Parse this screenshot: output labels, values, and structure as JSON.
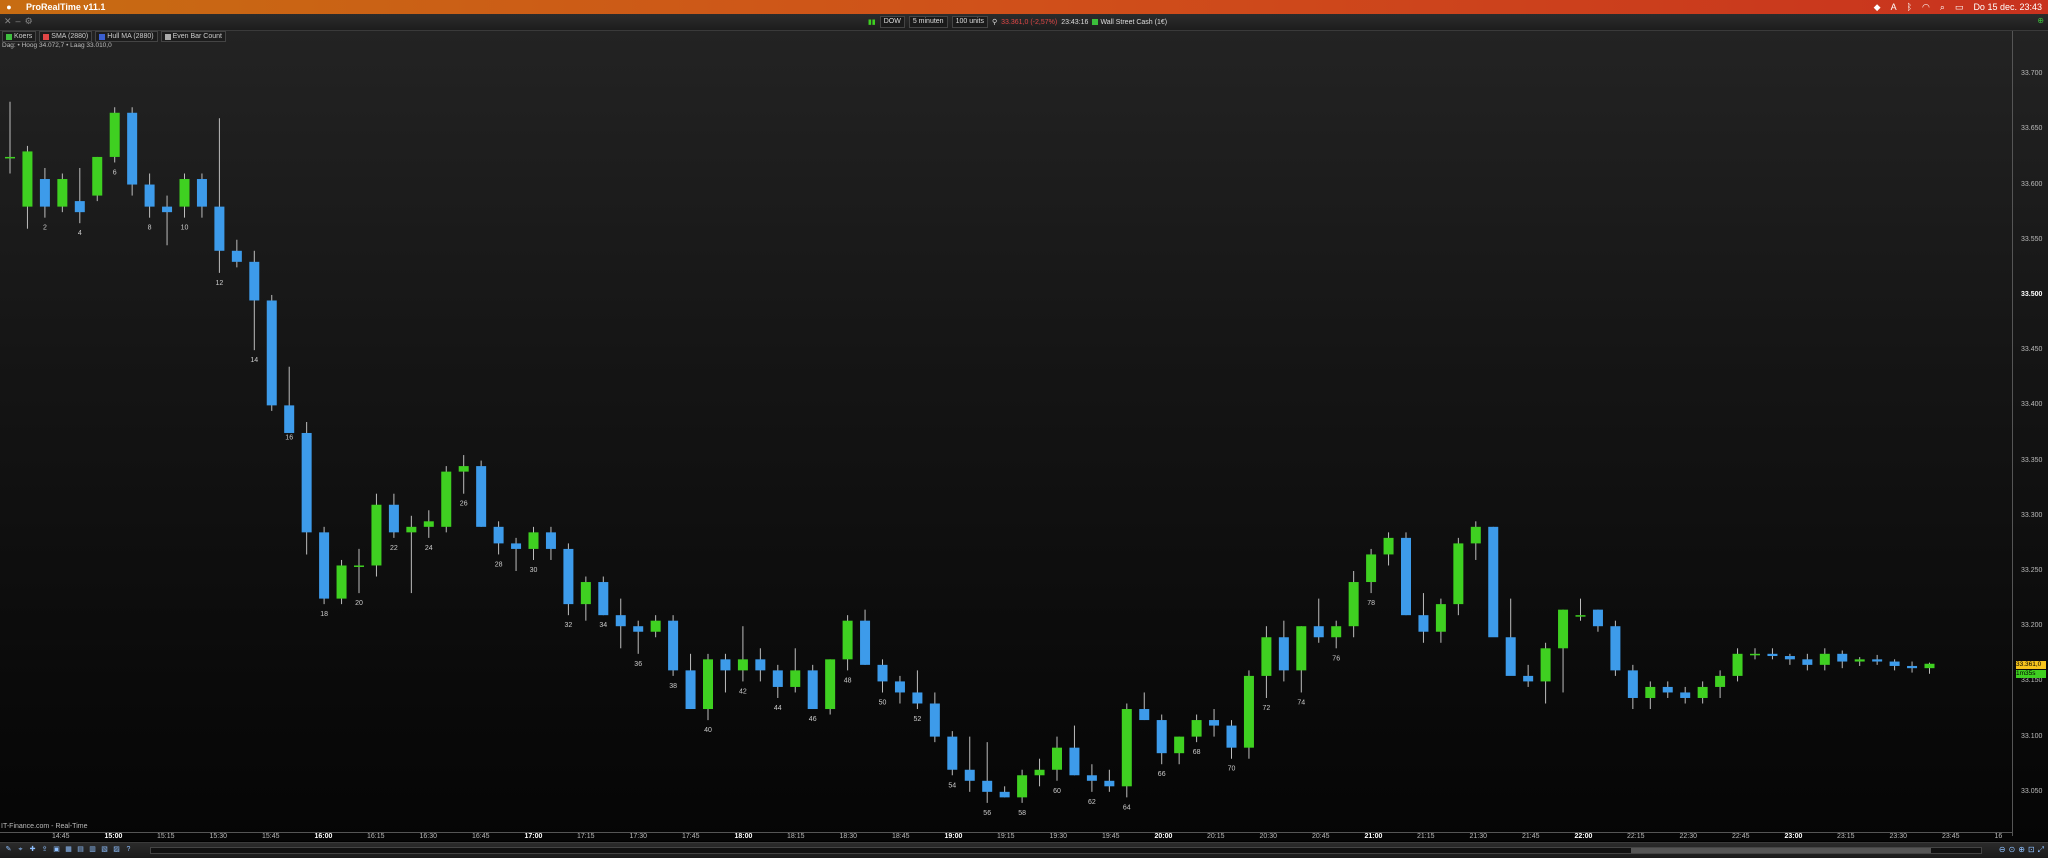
{
  "menubar": {
    "app_title": "ProRealTime v11.1",
    "datetime": "Do 15 dec. 23:43",
    "icons": [
      "apple-icon",
      "dropbox-icon",
      "a-icon",
      "bluetooth-icon",
      "wifi-icon",
      "search-icon",
      "screen-icon",
      "control-center-icon"
    ]
  },
  "toolbar": {
    "instrument": "DOW",
    "timeframe": "5 minuten",
    "units": "100 units",
    "last_price": "33.361,0 (-2,57%)",
    "time": "23:43:16",
    "instrument_name": "Wall Street Cash (1€)"
  },
  "legend": [
    {
      "label": "Koers",
      "color": "#3fbf3f"
    },
    {
      "label": "SMA (2880)",
      "color": "#e04646"
    },
    {
      "label": "Hull MA (2880)",
      "color": "#3a5fd0"
    },
    {
      "label": "Even Bar Count",
      "color": "#aaaaaa"
    }
  ],
  "info_line": "Dag: • Hoog 34.072,7 • Laag 33.010,0",
  "source_label": "IT-Finance.com - Real-Time",
  "colors": {
    "up": "#3fd021",
    "down": "#3d9bea",
    "wick": "#bdbdbd",
    "price_tag": "#f7c51d",
    "timer_tag": "#3fd021"
  },
  "price_axis": {
    "labels": [
      "33.700",
      "33.650",
      "33.600",
      "33.550",
      "33.500",
      "33.450",
      "33.400",
      "33.350",
      "33.300",
      "33.250",
      "33.200",
      "33.150",
      "33.100",
      "33.050"
    ],
    "bold": [
      "33.500"
    ]
  },
  "current_price_tag": "33.361,0",
  "timer_tag": "1m35s",
  "chart_data": {
    "type": "candlestick",
    "ylim": [
      33010,
      33730
    ],
    "time_labels": [
      "14:45",
      "15:00",
      "15:15",
      "15:30",
      "15:45",
      "16:00",
      "16:15",
      "16:30",
      "16:45",
      "17:00",
      "17:15",
      "17:30",
      "17:45",
      "18:00",
      "18:15",
      "18:30",
      "18:45",
      "19:00",
      "19:15",
      "19:30",
      "19:45",
      "20:00",
      "20:15",
      "20:30",
      "20:45",
      "21:00",
      "21:15",
      "21:30",
      "21:45",
      "22:00",
      "22:15",
      "22:30",
      "22:45",
      "23:00",
      "23:15",
      "23:30",
      "23:45",
      "16"
    ],
    "bold_time_labels": [
      "15:00",
      "16:00",
      "17:00",
      "18:00",
      "19:00",
      "20:00",
      "21:00",
      "22:00",
      "23:00"
    ],
    "bar_count_labels": [
      2,
      4,
      6,
      8,
      10,
      12,
      14,
      16,
      18,
      20,
      22,
      24,
      26,
      28,
      30,
      32,
      34,
      36,
      38,
      40,
      42,
      44,
      46,
      48,
      50,
      52,
      54,
      56,
      58,
      60,
      62,
      64,
      66,
      68,
      70,
      72,
      74,
      76,
      78
    ],
    "candles": [
      [
        33625,
        33675,
        33610,
        33625
      ],
      [
        33580,
        33635,
        33560,
        33630
      ],
      [
        33605,
        33615,
        33570,
        33580
      ],
      [
        33580,
        33610,
        33575,
        33605
      ],
      [
        33585,
        33615,
        33565,
        33575
      ],
      [
        33590,
        33625,
        33585,
        33625
      ],
      [
        33625,
        33670,
        33620,
        33665
      ],
      [
        33665,
        33670,
        33590,
        33600
      ],
      [
        33600,
        33610,
        33570,
        33580
      ],
      [
        33580,
        33590,
        33545,
        33575
      ],
      [
        33580,
        33610,
        33570,
        33605
      ],
      [
        33605,
        33610,
        33570,
        33580
      ],
      [
        33580,
        33660,
        33520,
        33540
      ],
      [
        33540,
        33550,
        33525,
        33530
      ],
      [
        33530,
        33540,
        33450,
        33495
      ],
      [
        33495,
        33500,
        33395,
        33400
      ],
      [
        33400,
        33435,
        33380,
        33375
      ],
      [
        33375,
        33385,
        33265,
        33285
      ],
      [
        33285,
        33290,
        33220,
        33225
      ],
      [
        33225,
        33260,
        33220,
        33255
      ],
      [
        33255,
        33270,
        33230,
        33255
      ],
      [
        33255,
        33320,
        33245,
        33310
      ],
      [
        33310,
        33320,
        33280,
        33285
      ],
      [
        33285,
        33300,
        33230,
        33290
      ],
      [
        33290,
        33305,
        33280,
        33295
      ],
      [
        33290,
        33345,
        33285,
        33340
      ],
      [
        33340,
        33355,
        33320,
        33345
      ],
      [
        33345,
        33350,
        33290,
        33290
      ],
      [
        33290,
        33295,
        33265,
        33275
      ],
      [
        33275,
        33280,
        33250,
        33270
      ],
      [
        33270,
        33290,
        33260,
        33285
      ],
      [
        33285,
        33290,
        33260,
        33270
      ],
      [
        33270,
        33275,
        33210,
        33220
      ],
      [
        33220,
        33245,
        33205,
        33240
      ],
      [
        33240,
        33245,
        33210,
        33210
      ],
      [
        33210,
        33225,
        33180,
        33200
      ],
      [
        33200,
        33205,
        33175,
        33195
      ],
      [
        33195,
        33210,
        33190,
        33205
      ],
      [
        33205,
        33210,
        33155,
        33160
      ],
      [
        33160,
        33175,
        33125,
        33125
      ],
      [
        33125,
        33175,
        33115,
        33170
      ],
      [
        33170,
        33175,
        33140,
        33160
      ],
      [
        33160,
        33200,
        33150,
        33170
      ],
      [
        33170,
        33180,
        33150,
        33160
      ],
      [
        33160,
        33165,
        33135,
        33145
      ],
      [
        33145,
        33180,
        33140,
        33160
      ],
      [
        33160,
        33165,
        33125,
        33125
      ],
      [
        33125,
        33170,
        33120,
        33170
      ],
      [
        33170,
        33210,
        33160,
        33205
      ],
      [
        33205,
        33215,
        33165,
        33165
      ],
      [
        33165,
        33170,
        33140,
        33150
      ],
      [
        33150,
        33155,
        33130,
        33140
      ],
      [
        33140,
        33160,
        33125,
        33130
      ],
      [
        33130,
        33140,
        33095,
        33100
      ],
      [
        33100,
        33105,
        33065,
        33070
      ],
      [
        33070,
        33100,
        33050,
        33060
      ],
      [
        33060,
        33095,
        33040,
        33050
      ],
      [
        33050,
        33055,
        33045,
        33045
      ],
      [
        33045,
        33070,
        33040,
        33065
      ],
      [
        33065,
        33080,
        33055,
        33070
      ],
      [
        33070,
        33100,
        33060,
        33090
      ],
      [
        33090,
        33110,
        33065,
        33065
      ],
      [
        33065,
        33075,
        33050,
        33060
      ],
      [
        33060,
        33070,
        33050,
        33055
      ],
      [
        33055,
        33130,
        33045,
        33125
      ],
      [
        33125,
        33140,
        33115,
        33115
      ],
      [
        33115,
        33120,
        33075,
        33085
      ],
      [
        33085,
        33100,
        33075,
        33100
      ],
      [
        33100,
        33120,
        33095,
        33115
      ],
      [
        33115,
        33125,
        33100,
        33110
      ],
      [
        33110,
        33115,
        33080,
        33090
      ],
      [
        33090,
        33160,
        33080,
        33155
      ],
      [
        33155,
        33200,
        33135,
        33190
      ],
      [
        33190,
        33205,
        33150,
        33160
      ],
      [
        33160,
        33200,
        33140,
        33200
      ],
      [
        33200,
        33225,
        33185,
        33190
      ],
      [
        33190,
        33205,
        33180,
        33200
      ],
      [
        33200,
        33250,
        33190,
        33240
      ],
      [
        33240,
        33270,
        33230,
        33265
      ],
      [
        33265,
        33285,
        33255,
        33280
      ],
      [
        33280,
        33285,
        33210,
        33210
      ],
      [
        33210,
        33230,
        33185,
        33195
      ],
      [
        33195,
        33225,
        33185,
        33220
      ],
      [
        33220,
        33280,
        33210,
        33275
      ],
      [
        33275,
        33295,
        33260,
        33290
      ],
      [
        33290,
        33290,
        33195,
        33190
      ],
      [
        33190,
        33225,
        33175,
        33155
      ],
      [
        33155,
        33165,
        33145,
        33150
      ],
      [
        33150,
        33185,
        33130,
        33180
      ],
      [
        33180,
        33215,
        33140,
        33215
      ],
      [
        33210,
        33225,
        33205,
        33210
      ],
      [
        33215,
        33215,
        33195,
        33200
      ],
      [
        33200,
        33205,
        33155,
        33160
      ],
      [
        33160,
        33165,
        33125,
        33135
      ],
      [
        33135,
        33150,
        33125,
        33145
      ],
      [
        33145,
        33150,
        33135,
        33140
      ],
      [
        33140,
        33145,
        33130,
        33135
      ],
      [
        33135,
        33150,
        33130,
        33145
      ],
      [
        33145,
        33160,
        33135,
        33155
      ],
      [
        33155,
        33180,
        33150,
        33175
      ],
      [
        33175,
        33180,
        33170,
        33175
      ],
      [
        33175,
        33180,
        33170,
        33173
      ],
      [
        33173,
        33175,
        33165,
        33170
      ],
      [
        33170,
        33175,
        33160,
        33165
      ],
      [
        33165,
        33180,
        33160,
        33175
      ],
      [
        33175,
        33178,
        33162,
        33168
      ],
      [
        33168,
        33172,
        33164,
        33170
      ],
      [
        33170,
        33174,
        33165,
        33168
      ],
      [
        33168,
        33170,
        33160,
        33164
      ],
      [
        33164,
        33168,
        33158,
        33162
      ],
      [
        33162,
        33167,
        33157,
        33166
      ]
    ]
  }
}
